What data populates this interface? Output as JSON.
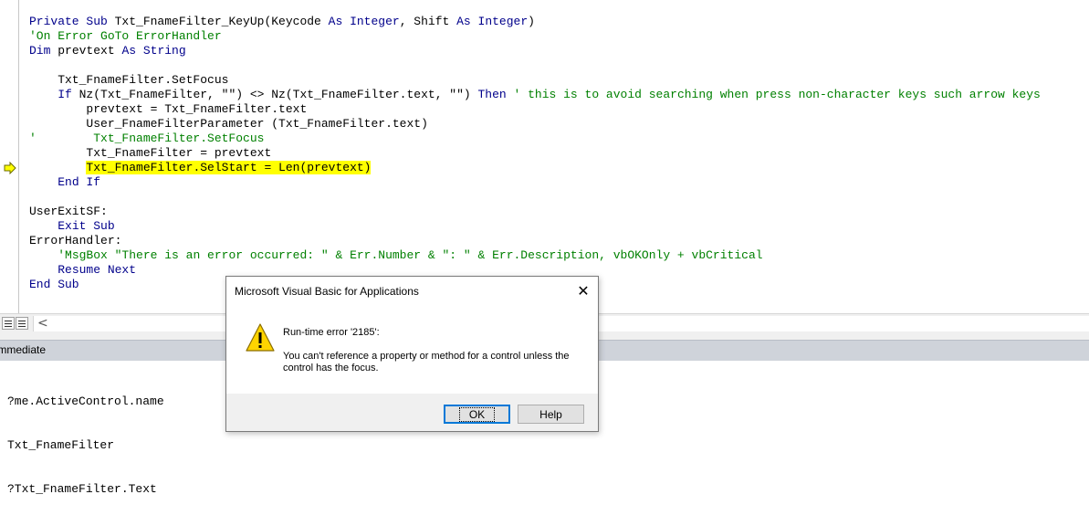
{
  "code_lines": [
    [
      {
        "t": "Private Sub ",
        "c": "kw"
      },
      {
        "t": "Txt_FnameFilter_KeyUp(Keycode "
      },
      {
        "t": "As Integer",
        "c": "kw"
      },
      {
        "t": ", Shift "
      },
      {
        "t": "As Integer",
        "c": "kw"
      },
      {
        "t": ")"
      }
    ],
    [
      {
        "t": "'On Error GoTo ErrorHandler",
        "c": "cm"
      }
    ],
    [
      {
        "t": "Dim ",
        "c": "kw"
      },
      {
        "t": "prevtext "
      },
      {
        "t": "As String",
        "c": "kw"
      }
    ],
    [
      {
        "t": ""
      }
    ],
    [
      {
        "t": "    Txt_FnameFilter.SetFocus"
      }
    ],
    [
      {
        "t": "    "
      },
      {
        "t": "If ",
        "c": "kw"
      },
      {
        "t": "Nz(Txt_FnameFilter, \"\") <> Nz(Txt_FnameFilter.text, \"\") "
      },
      {
        "t": "Then ",
        "c": "kw"
      },
      {
        "t": "' this is to avoid searching when press non-character keys such arrow keys",
        "c": "cm"
      }
    ],
    [
      {
        "t": "        prevtext = Txt_FnameFilter.text"
      }
    ],
    [
      {
        "t": "        User_FnameFilterParameter (Txt_FnameFilter.text)"
      }
    ],
    [
      {
        "t": "'        Txt_FnameFilter.SetFocus",
        "c": "cm"
      }
    ],
    [
      {
        "t": "        Txt_FnameFilter = prevtext"
      }
    ],
    [
      {
        "t": "        "
      },
      {
        "t": "Txt_FnameFilter.SelStart = Len(prevtext)",
        "c": "hl"
      }
    ],
    [
      {
        "t": "    "
      },
      {
        "t": "End If",
        "c": "kw"
      }
    ],
    [
      {
        "t": ""
      }
    ],
    [
      {
        "t": "UserExitSF:"
      }
    ],
    [
      {
        "t": "    "
      },
      {
        "t": "Exit Sub",
        "c": "kw"
      }
    ],
    [
      {
        "t": "ErrorHandler:"
      }
    ],
    [
      {
        "t": "    "
      },
      {
        "t": "'MsgBox \"There is an error occurred: \" & Err.Number & \": \" & Err.Description, vbOKOnly + vbCritical",
        "c": "cm"
      }
    ],
    [
      {
        "t": "    "
      },
      {
        "t": "Resume Next",
        "c": "kw"
      }
    ],
    [
      {
        "t": "End Sub",
        "c": "kw"
      }
    ]
  ],
  "immediate": {
    "title": "Immediate",
    "lines": [
      "?me.ActiveControl.name",
      "Txt_FnameFilter",
      "?Txt_FnameFilter.Text"
    ]
  },
  "dialog": {
    "title": "Microsoft Visual Basic for Applications",
    "error_title": "Run-time error '2185':",
    "message": "You can't reference a property or method for a control unless the control has the focus.",
    "ok_label": "OK",
    "help_label": "Help",
    "close_glyph": "✕"
  },
  "editor": {
    "scroll_left_glyph": "<"
  },
  "colors": {
    "keyword": "#00008b",
    "comment": "#008000",
    "highlight": "#ffff00",
    "exec_arrow": "#ffff00"
  },
  "icons": {
    "execution_marker": "arrow-right-icon",
    "warning": "warning-icon",
    "close": "close-icon",
    "procedure_view": "procedure-view-icon",
    "full_module_view": "full-module-view-icon"
  }
}
